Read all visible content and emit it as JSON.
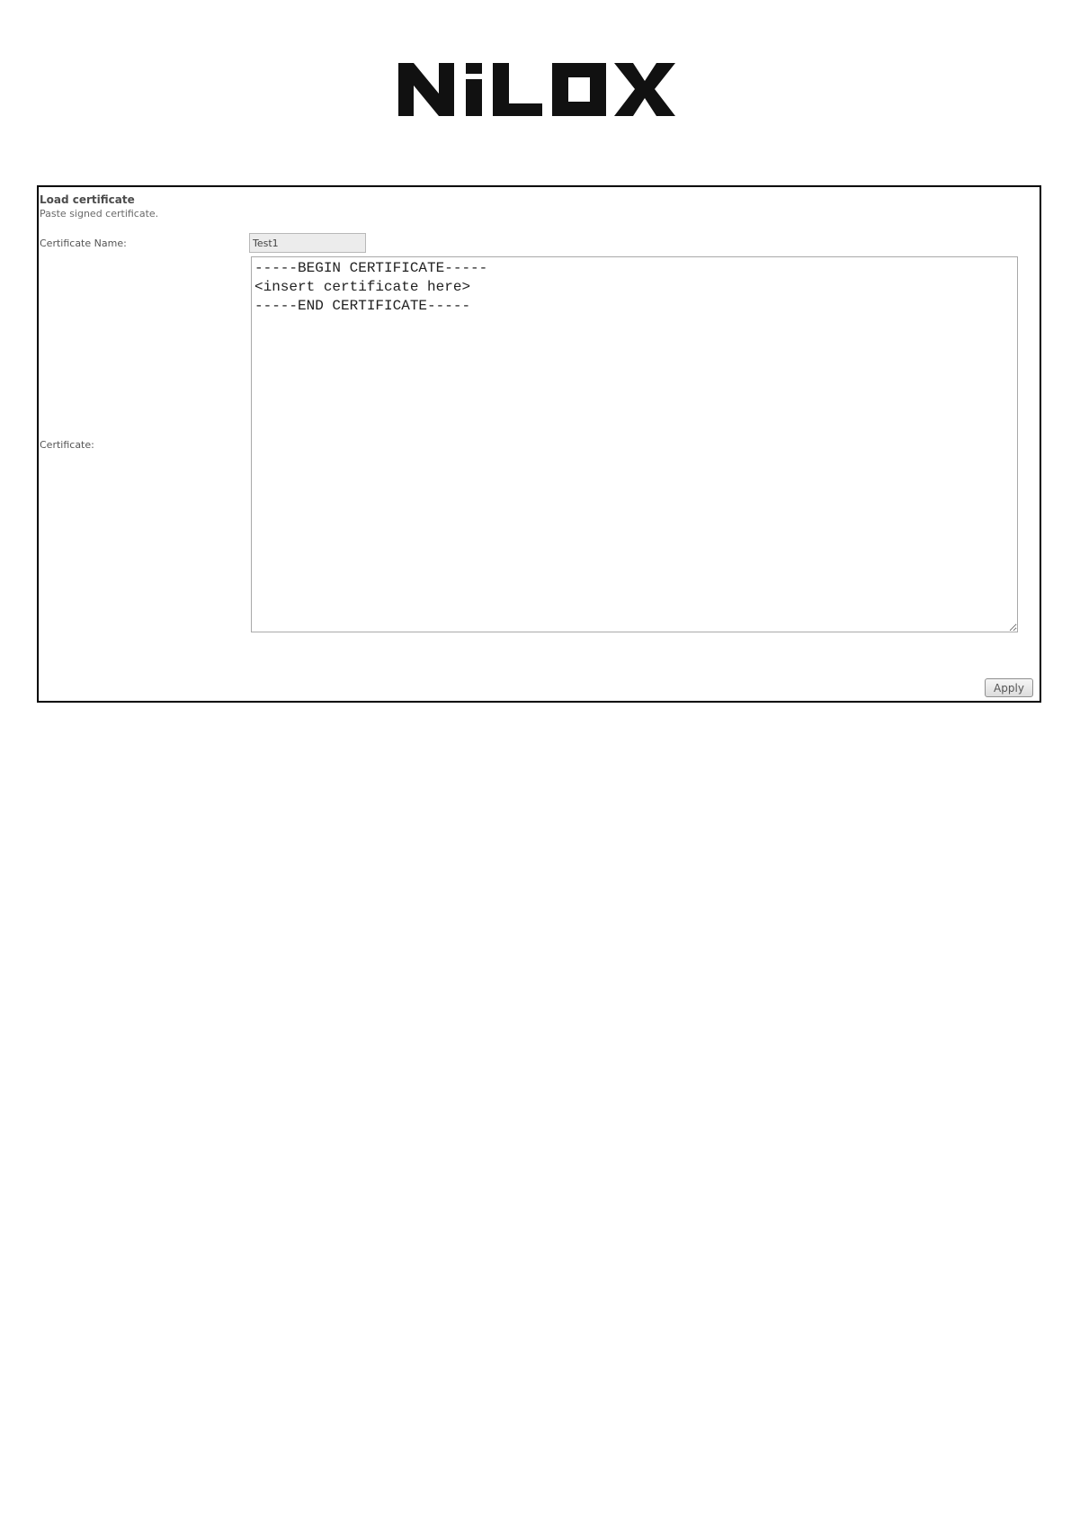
{
  "brand": {
    "logo_text": "NILOX"
  },
  "panel": {
    "title": "Load certificate",
    "subtitle": "Paste signed certificate.",
    "certificate_name": {
      "label": "Certificate Name:",
      "value": "Test1"
    },
    "certificate": {
      "label": "Certificate:",
      "value": "-----BEGIN CERTIFICATE-----\n<insert certificate here>\n-----END CERTIFICATE-----"
    },
    "apply_label": "Apply"
  },
  "colors": {
    "logo": "#111111",
    "panel_border": "#000000",
    "input_background": "#ececec"
  }
}
